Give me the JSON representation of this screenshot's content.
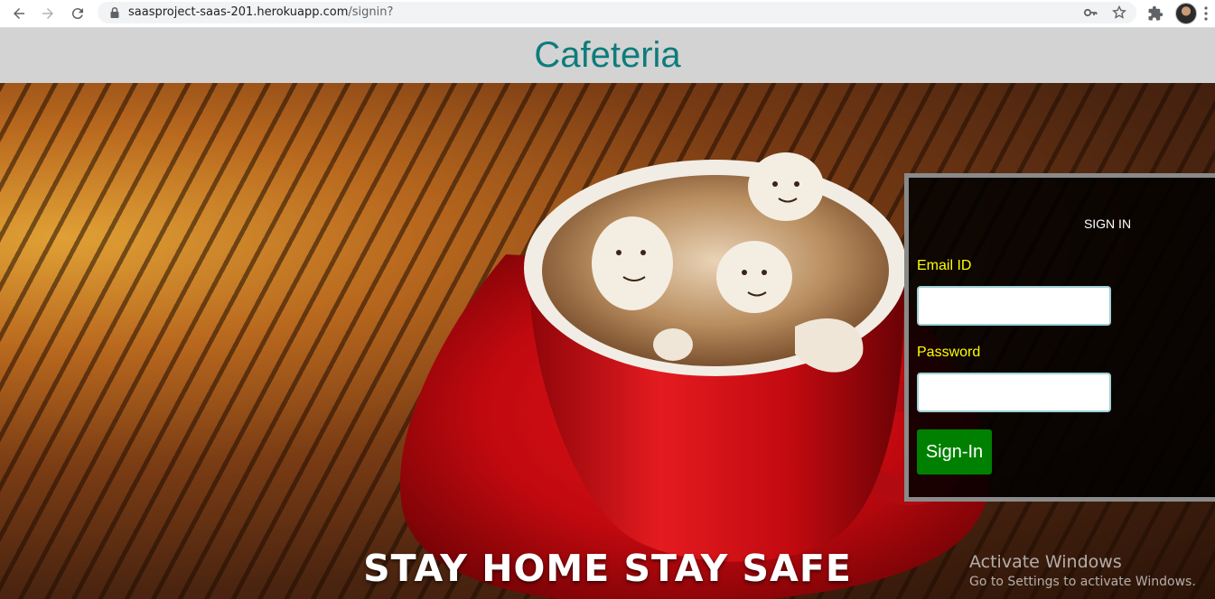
{
  "browser": {
    "url_host": "saasproject-saas-201.herokuapp.com",
    "url_path": "/signin?",
    "icons": {
      "back": "back-arrow-icon",
      "forward": "forward-arrow-icon",
      "reload": "reload-icon",
      "lock": "lock-icon",
      "key": "key-icon",
      "star": "bookmark-star-icon",
      "extensions": "puzzle-icon",
      "menu": "kebab-menu-icon"
    }
  },
  "site": {
    "title": "Cafeteria",
    "title_color": "#0e7c7b",
    "header_bg": "#d3d3d3"
  },
  "hero": {
    "slogan": "STAY HOME STAY SAFE"
  },
  "signin": {
    "heading": "SIGN IN",
    "email_label": "Email ID",
    "email_value": "",
    "password_label": "Password",
    "password_value": "",
    "button_label": "Sign-In",
    "label_color": "#ffff00",
    "button_color": "#008000"
  },
  "os_watermark": {
    "title": "Activate Windows",
    "subtitle": "Go to Settings to activate Windows."
  }
}
